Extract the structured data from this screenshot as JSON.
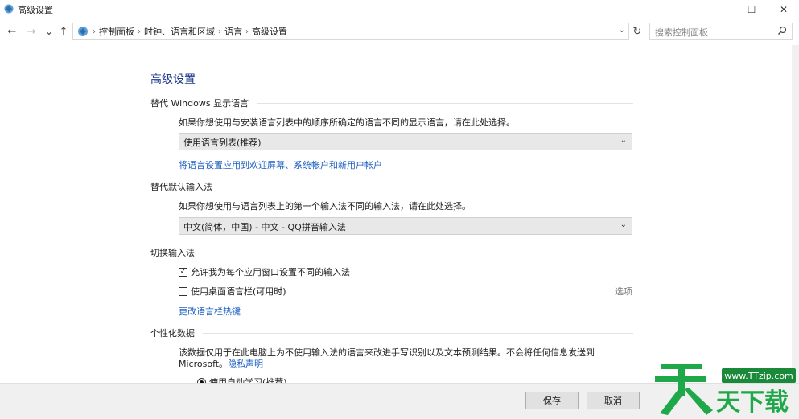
{
  "window": {
    "title": "高级设置",
    "controls": {
      "minimize": "—",
      "maximize": "☐",
      "close": "✕"
    }
  },
  "nav": {
    "back": "←",
    "forward": "→",
    "recent": "⌄",
    "up": "↑",
    "breadcrumbs": [
      "控制面板",
      "时钟、语言和区域",
      "语言",
      "高级设置"
    ],
    "separator": "›",
    "refresh": "↻",
    "search_placeholder": "搜索控制面板"
  },
  "page": {
    "title": "高级设置",
    "sections": {
      "display_language": {
        "heading": "替代 Windows 显示语言",
        "description": "如果你想使用与安装语言列表中的顺序所确定的语言不同的显示语言，请在此处选择。",
        "selected": "使用语言列表(推荐)",
        "link": "将语言设置应用到欢迎屏幕、系统帐户和新用户帐户"
      },
      "default_input": {
        "heading": "替代默认输入法",
        "description": "如果你想使用与语言列表上的第一个输入法不同的输入法，请在此处选择。",
        "selected": "中文(简体，中国) - 中文 - QQ拼音输入法"
      },
      "switch_input": {
        "heading": "切换输入法",
        "checkbox_per_app": {
          "label": "允许我为每个应用窗口设置不同的输入法",
          "checked": true
        },
        "checkbox_langbar": {
          "label": "使用桌面语言栏(可用时)",
          "checked": false
        },
        "options_link": "选项",
        "hotkey_link": "更改语言栏热键"
      },
      "personalization": {
        "heading": "个性化数据",
        "description_line1": "该数据仅用于在此电脑上为不使用输入法的语言来改进手写识别以及文本预测结果。不会将任何信息发送到",
        "description_line2_prefix": "Microsoft。",
        "privacy_link": "隐私声明",
        "radio_auto": {
          "label": "使用自动学习(推荐)",
          "selected": true
        }
      }
    }
  },
  "footer": {
    "save": "保存",
    "cancel": "取消"
  },
  "watermark": {
    "url": "www.TTzip.com",
    "text": "天天下载"
  },
  "colors": {
    "accent_link": "#1b5fbf",
    "title_blue": "#1e3a8a",
    "watermark_green": "#1a8a3a"
  }
}
